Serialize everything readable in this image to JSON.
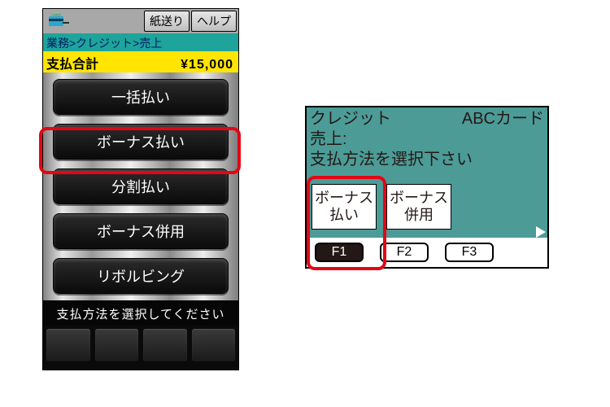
{
  "left": {
    "top_buttons": {
      "feed": "紙送り",
      "help": "ヘルプ"
    },
    "breadcrumb": "業務>クレジット>売上",
    "total_label": "支払合計",
    "total_amount": "¥15,000",
    "options": [
      "一括払い",
      "ボーナス払い",
      "分割払い",
      "ボーナス併用",
      "リボルビング"
    ],
    "prompt": "支払方法を選択してください"
  },
  "right": {
    "header_left": "クレジット",
    "header_right": "ABCカード",
    "line2": "売上:",
    "line3": "支払方法を選択下さい",
    "options": [
      "ボーナス\n払い",
      "ボーナス\n併用"
    ],
    "fkeys": [
      "F1",
      "F2",
      "F3"
    ]
  }
}
